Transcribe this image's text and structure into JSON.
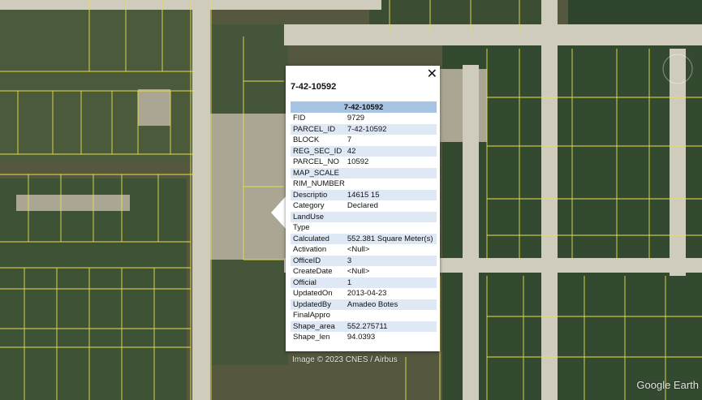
{
  "balloon": {
    "title": "7-42-10592",
    "header": "7-42-10592",
    "close_label": "✕",
    "rows": [
      {
        "k": "FID",
        "v": "9729"
      },
      {
        "k": "PARCEL_ID",
        "v": "7-42-10592"
      },
      {
        "k": "BLOCK",
        "v": "7"
      },
      {
        "k": "REG_SEC_ID",
        "v": "42"
      },
      {
        "k": "PARCEL_NO",
        "v": "10592"
      },
      {
        "k": "MAP_SCALE",
        "v": ""
      },
      {
        "k": "RIM_NUMBER",
        "v": ""
      },
      {
        "k": "Descriptio",
        "v": "14615 15"
      },
      {
        "k": "Category",
        "v": "Declared"
      },
      {
        "k": "LandUse",
        "v": ""
      },
      {
        "k": "Type",
        "v": ""
      },
      {
        "k": "Calculated",
        "v": "552.381 Square Meter(s)"
      },
      {
        "k": "Activation",
        "v": "<Null>"
      },
      {
        "k": "OfficeID",
        "v": "3"
      },
      {
        "k": "CreateDate",
        "v": "<Null>"
      },
      {
        "k": "Official",
        "v": "1"
      },
      {
        "k": "UpdatedOn",
        "v": "2013-04-23"
      },
      {
        "k": "UpdatedBy",
        "v": "Amadeo Botes"
      },
      {
        "k": "FinalAppro",
        "v": ""
      },
      {
        "k": "Shape_area",
        "v": "552.275711"
      },
      {
        "k": "Shape_len",
        "v": "94.0393"
      }
    ]
  },
  "map": {
    "credit": "Image © 2023 CNES / Airbus",
    "brand": "Google Earth"
  },
  "colors": {
    "parcel_line": "#e6e04a",
    "vegetation": "#3b4f34",
    "sand": "#b9b5a2",
    "road": "#d4d0c4",
    "header_bg": "#a8c4e4",
    "row_alt_bg": "#dfe8f5"
  }
}
